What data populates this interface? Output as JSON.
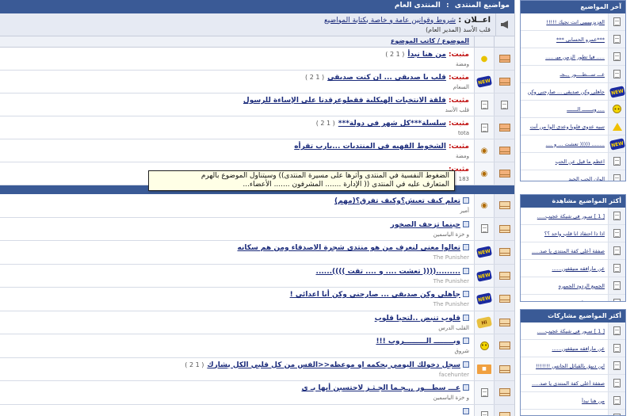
{
  "main": {
    "breadcrumb": [
      "مواضيع المنتدى",
      ":",
      "المنتدى العام"
    ],
    "announcement": {
      "label": "اعــلان :",
      "title": "شروط وقوانين عامة و خاصة بكتابة المواضيع",
      "sub": "قلب الأسد",
      "sub_role": "(المدير العام)"
    },
    "col_header": "الموضوع / كاتب الموضوع",
    "sticky_label": "مثبت:",
    "sticky": [
      {
        "title": "من هنا نبدأ",
        "pages": "( 1 2 )",
        "poster": "ومضة",
        "icon": "bulb-icon",
        "status": "hot"
      },
      {
        "title": "قلب يا صديقي ... ان كنت صديقي",
        "pages": "( 1 2 )",
        "poster": "السعام",
        "icon": "new-badge-icon",
        "status": "hot"
      },
      {
        "title": "فلقة الانتخبات الهيكلية فقطوعرقدنا على الإساءة للرسول",
        "pages": "",
        "poster": "قلب الأسد",
        "icon": "doc-icon",
        "status": "normal"
      },
      {
        "title": "سلسلة***كل شهر في دولة***",
        "pages": "( 1 2 )",
        "poster": "tota",
        "icon": "doc-icon",
        "status": "hot"
      },
      {
        "title": "الشخوط الفهيه في المنتديات ...يارب تقرأه",
        "pages": "",
        "poster": "ومضة",
        "icon": "bag-icon",
        "status": "hot"
      },
      {
        "title": "",
        "pages": "",
        "poster": "183",
        "icon": "bag-icon",
        "status": "hot"
      }
    ],
    "topics": [
      {
        "title": "تعلم كيف تعيش؟وكيف تفرق؟(مهم)",
        "pages": "",
        "poster": "أمير",
        "icon": "bag-icon",
        "poster_grey": false
      },
      {
        "title": "حينما تزحف الصخور",
        "pages": "",
        "poster": "و خزة الياسمين",
        "icon": "doc-icon",
        "poster_grey": false
      },
      {
        "title": "تعالوا معنى لنعرف من هو منتدى شجرة الاصدقاء ومن هم سكانه",
        "pages": "",
        "poster": "The Punisher",
        "icon": "new-badge-icon",
        "poster_grey": true
      },
      {
        "title": ".........(((( تعشت .... و .... تقت ))))......",
        "pages": "",
        "poster": "The Punisher",
        "icon": "new-badge-icon",
        "poster_grey": true
      },
      {
        "title": "جاهلي وكن صديقي ... صارحني وكن أنا اعدائي !",
        "pages": "",
        "poster": "The Punisher",
        "icon": "new-badge-icon",
        "poster_grey": true
      },
      {
        "title": "قلوب تنبض ..لتحيا قلوب",
        "pages": "",
        "poster": "القلب الدرس",
        "icon": "welcome-icon",
        "poster_grey": false
      },
      {
        "title": "وبــــــــ الـــــــــروب !!!",
        "pages": "",
        "poster": "شروق",
        "icon": "smile-icon",
        "poster_grey": false
      },
      {
        "title": "سجل دخولك اليومي بحكمه او موعظه<<الفس من كل قلبي الكل يشارك",
        "pages": "( 1 2 )",
        "poster": "facehunter",
        "icon": "label-icon",
        "poster_grey": true
      },
      {
        "title": "عـــ سطـــور ,,ـجـما الجـثـز لاحتسبن أيها بـ ي",
        "pages": "",
        "poster": "و خزة الياسمين",
        "icon": "doc-icon",
        "poster_grey": false
      },
      {
        "title": "",
        "pages": "",
        "poster": "",
        "icon": "doc-icon",
        "poster_grey": false
      }
    ]
  },
  "tooltip": {
    "line1": "الضغوط النفسية في المنتدى وأثرها على مسيرة المنتدى)) وسيتناول الموضوع بالهرم",
    "line2": "المتعارف عليه في المنتدى (( الإدارة ....... المشرفون ....... الأعضاء..."
  },
  "sidebar": {
    "latest": {
      "title": "آخر المواضيع",
      "items": [
        {
          "text": "العزيزيييييي انت نجيك !!!!!",
          "icon": "doc-icon"
        },
        {
          "text": "***عمرو الحسابي ***",
          "icon": "doc-icon"
        },
        {
          "text": "..... فيا تطور الزمن ميـ .....",
          "icon": "doc-icon"
        },
        {
          "text": "عـــ ســـطــــور ,,ـجـ",
          "icon": "doc-icon"
        },
        {
          "text": "جاهلي وكن صديقي ... صارحني وكن",
          "icon": "new-badge-icon"
        },
        {
          "text": ".... وبـــــــ الـــــــ",
          "icon": "smile-icon"
        },
        {
          "text": "تنبيه عدوي فلوبا وعدي الوا من أنت",
          "icon": "warning-icon"
        },
        {
          "text": "........ ((((( تعشت ... و ....",
          "icon": "new-badge-icon"
        },
        {
          "text": "اعظم ما قيل عن الحب",
          "icon": "doc-icon"
        },
        {
          "text": "الوان الحب الجيد",
          "icon": "doc-icon"
        }
      ]
    },
    "most_viewed": {
      "title": "أكثر المواضيع مشاهدة",
      "items": [
        {
          "text": "[ 1 ] سـور في شبكة عجيب.....",
          "icon": "doc-icon"
        },
        {
          "text": "اذا ذا احتقاذ انا قلب واحد ؟؟",
          "icon": "doc-icon"
        },
        {
          "text": "صفقة أعلى كفة المنتدى يا صد.....",
          "icon": "doc-icon"
        },
        {
          "text": "عن مارافقه منيقفين......",
          "icon": "doc-icon"
        },
        {
          "text": "الجميع الردود الجميره",
          "icon": "doc-icon"
        },
        {
          "text": "من هنا نبدأ",
          "icon": "doc-icon"
        }
      ]
    },
    "most_replied": {
      "title": "أكثر المواضيع مشاركات",
      "items": [
        {
          "text": "[ 1 ] سـور في شبكة عجيب.....",
          "icon": "doc-icon"
        },
        {
          "text": "عن مارافقه منيقفين......",
          "icon": "doc-icon"
        },
        {
          "text": "ابن دبيق بالقبائل الجانس !!!!!!!",
          "icon": "doc-icon"
        },
        {
          "text": "صفقة أعلى كفة المنتدى يا صد.....",
          "icon": "doc-icon"
        },
        {
          "text": "من هنا نبدأ",
          "icon": "doc-icon"
        },
        {
          "text": "سجل دخولك اليومي بحكمه او موعظه....",
          "icon": "doc-icon"
        }
      ]
    }
  },
  "colors": {
    "header_bg": "#3a5a96",
    "link": "#1a2a7a",
    "sticky": "#c01010",
    "tooltip_bg": "#ffffe6"
  }
}
